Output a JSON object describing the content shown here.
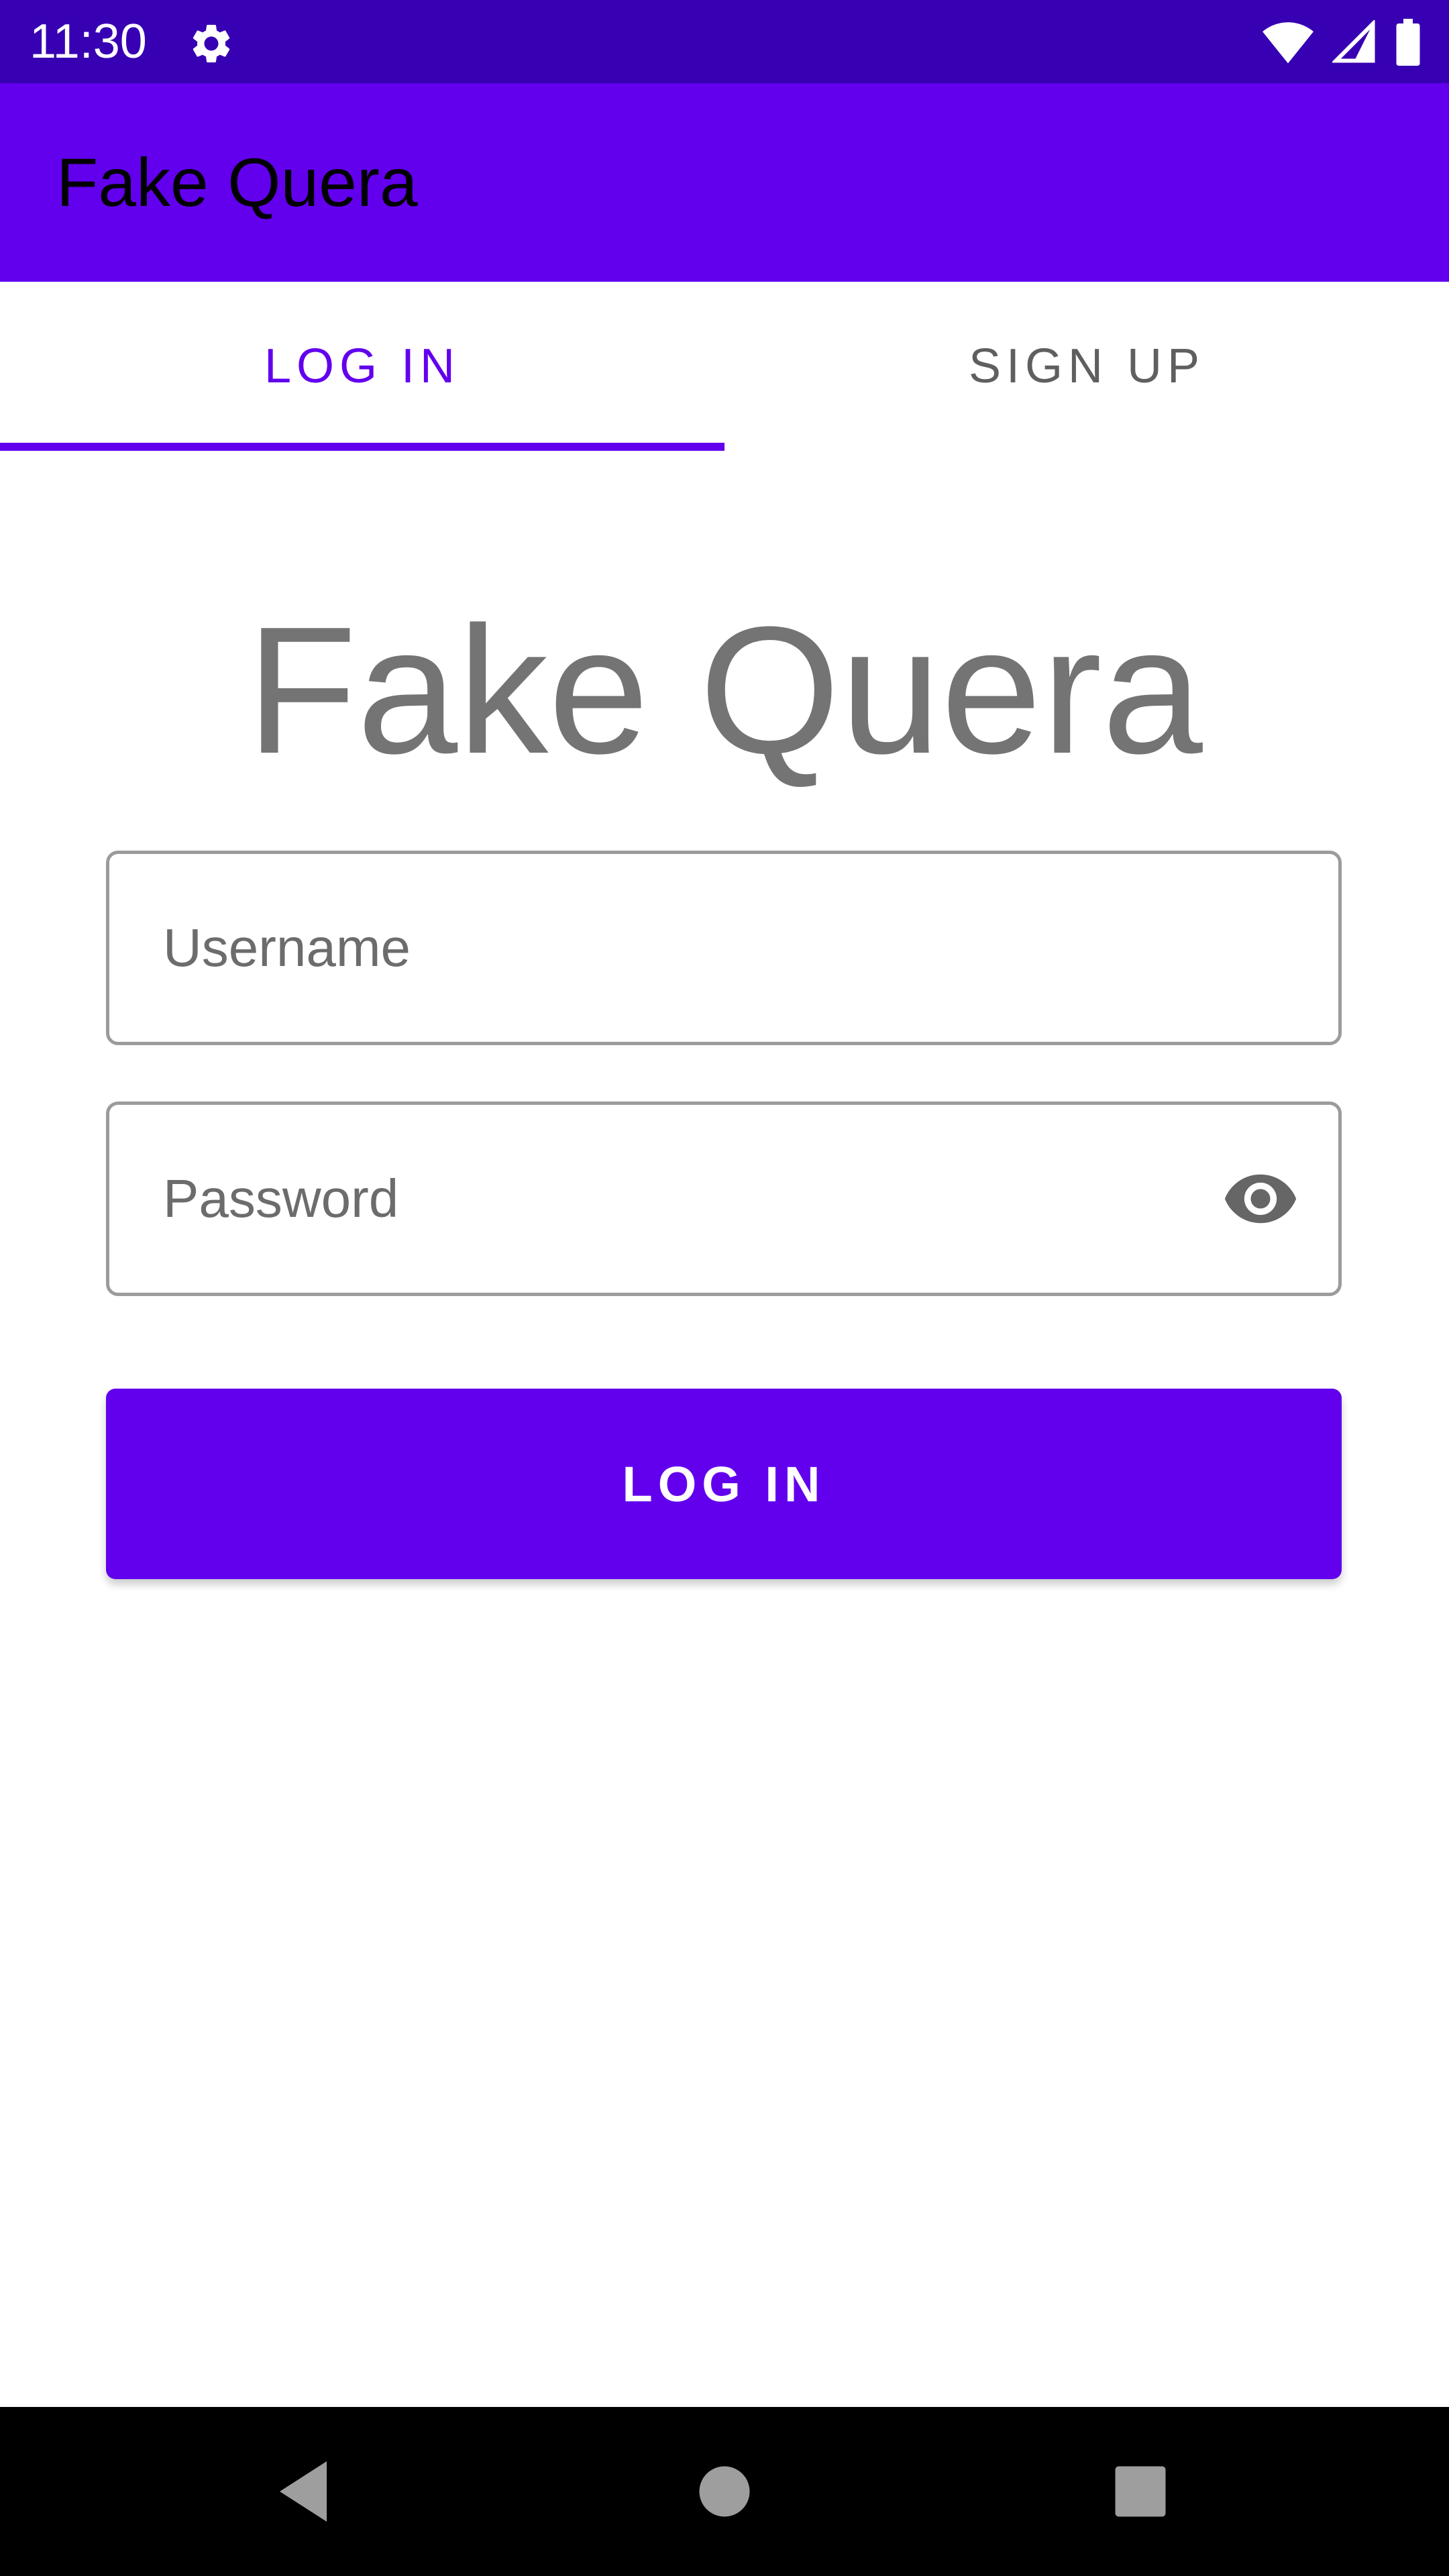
{
  "status_bar": {
    "time": "11:30",
    "icons": [
      "gear-icon",
      "wifi-icon",
      "signal-icon",
      "battery-icon"
    ]
  },
  "app_bar": {
    "title": "Fake Quera"
  },
  "tabs": [
    {
      "label": "LOG IN",
      "selected": true
    },
    {
      "label": "SIGN UP",
      "selected": false
    }
  ],
  "main": {
    "title": "Fake Quera",
    "username": {
      "value": "",
      "placeholder": "Username"
    },
    "password": {
      "value": "",
      "placeholder": "Password",
      "toggle_icon": "eye-icon"
    },
    "login_button": "LOG IN"
  },
  "nav_bar": {
    "buttons": [
      "back-icon",
      "home-icon",
      "recents-icon"
    ]
  },
  "colors": {
    "primary": "#6200ee",
    "primary_dark": "#3700b3",
    "title_gray": "#747474",
    "nav_icon": "#9e9e9e"
  }
}
